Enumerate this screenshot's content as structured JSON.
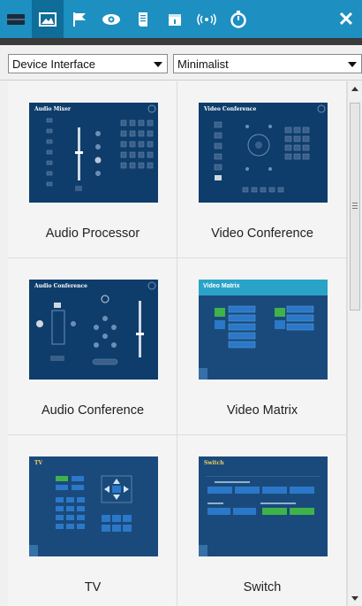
{
  "toolbar": {
    "buttons": [
      {
        "icon": "layout-icon",
        "glyph": "▬"
      },
      {
        "icon": "image-icon",
        "glyph": "▨"
      },
      {
        "icon": "flag-icon",
        "glyph": "⚑"
      },
      {
        "icon": "eye-icon",
        "glyph": "◉"
      },
      {
        "icon": "document-icon",
        "glyph": "▤"
      },
      {
        "icon": "calendar-icon",
        "glyph": "▦"
      },
      {
        "icon": "broadcast-icon",
        "glyph": "((•))"
      },
      {
        "icon": "stopwatch-icon",
        "glyph": "◔"
      }
    ],
    "close": "✕"
  },
  "filters": {
    "category": "Device Interface",
    "style": "Minimalist"
  },
  "templates": [
    {
      "label": "Audio Processor",
      "thumb_title": "Audio Mixer"
    },
    {
      "label": "Video Conference",
      "thumb_title": "Video Conference"
    },
    {
      "label": "Audio Conference",
      "thumb_title": "Audio Conference"
    },
    {
      "label": "Video Matrix",
      "thumb_title": "Video Matrix"
    },
    {
      "label": "TV",
      "thumb_title": "TV"
    },
    {
      "label": "Switch",
      "thumb_title": "Switch"
    }
  ],
  "colors": {
    "toolbar": "#1d8fc0",
    "thumbnail_bg": "#0e3d6b",
    "accent_bar": "#2aa3c9",
    "green": "#3fb24a"
  }
}
